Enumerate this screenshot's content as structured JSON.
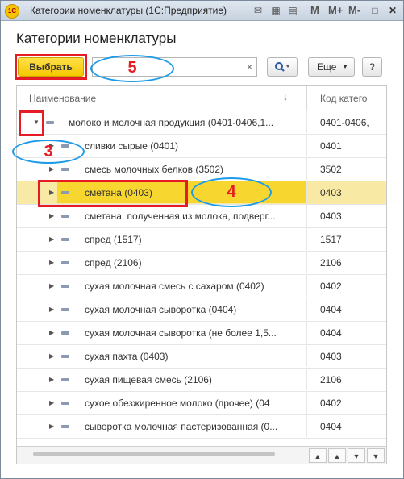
{
  "window": {
    "title": "Категории номенклатуры  (1С:Предприятие)",
    "toolbar_letters": [
      "M",
      "M+",
      "M-"
    ]
  },
  "heading": "Категории номенклатуры",
  "toolbar": {
    "select_label": "Выбрать",
    "more_label": "Еще",
    "help_label": "?",
    "clear_label": "×"
  },
  "annotations": {
    "n5": "5",
    "n3": "3",
    "n4": "4"
  },
  "table": {
    "columns": {
      "name": "Наименование",
      "code": "Код катего"
    },
    "parent": {
      "name": "молоко и молочная продукция (0401-0406,1...",
      "code": "0401-0406,"
    },
    "rows": [
      {
        "name": "сливки сырые (0401)",
        "code": "0401"
      },
      {
        "name": "смесь молочных белков (3502)",
        "code": "3502"
      },
      {
        "name": "сметана (0403)",
        "code": "0403"
      },
      {
        "name": "сметана, полученная из молока, подверг...",
        "code": "0403"
      },
      {
        "name": "спред (1517)",
        "code": "1517"
      },
      {
        "name": "спред (2106)",
        "code": "2106"
      },
      {
        "name": "сухая молочная смесь с сахаром (0402)",
        "code": "0402"
      },
      {
        "name": "сухая молочная сыворотка (0404)",
        "code": "0404"
      },
      {
        "name": "сухая молочная сыворотка (не более 1,5...",
        "code": "0404"
      },
      {
        "name": "сухая пахта (0403)",
        "code": "0403"
      },
      {
        "name": "сухая пищевая смесь (2106)",
        "code": "2106"
      },
      {
        "name": "сухое обезжиренное молоко (прочее) (04",
        "code": "0402"
      },
      {
        "name": "сыворотка молочная пастеризованная (0...",
        "code": "0404"
      }
    ],
    "selected_index": 2
  }
}
